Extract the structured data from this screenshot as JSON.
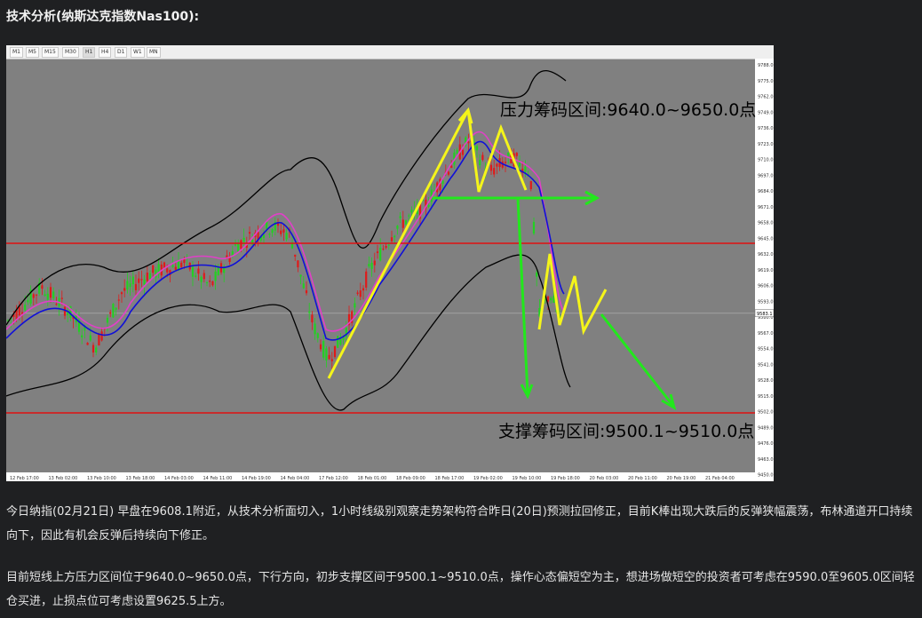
{
  "article": {
    "heading": "技术分析(纳斯达克指数Nas100):",
    "paragraph_1": "今日纳指(02月21日) 早盘在9608.1附近，从技术分析面切入，1小时线级别观察走势架构符合昨日(20日)预测拉回修正，目前K棒出现大跌后的反弹狭幅震荡，布林通道开口持续向下，因此有机会反弹后持续向下修正。",
    "paragraph_2": "目前短线上方压力区间位于9640.0~9650.0点，下行方向，初步支撑区间于9500.1~9510.0点，操作心态偏短空为主，想进场做短空的投资者可考虑在9590.0至9605.0区间轻仓买进，止损点位可考虑设置9625.5上方。"
  },
  "chart": {
    "timeframes": [
      "M1",
      "M5",
      "M15",
      "M30",
      "H1",
      "H4",
      "D1",
      "W1",
      "MN"
    ],
    "active_timeframe": "H1",
    "resistance_label": "压力筹码区间:9640.0~9650.0点",
    "support_label": "支撑筹码区间:9500.1~9510.0点",
    "price_axis_labels": [
      "9788.0",
      "9775.0",
      "9762.0",
      "9749.0",
      "9736.0",
      "9723.0",
      "9710.0",
      "9697.0",
      "9684.0",
      "9671.0",
      "9658.0",
      "9645.0",
      "9632.0",
      "9619.0",
      "9606.0",
      "9593.0",
      "9580.0",
      "9567.0",
      "9554.0",
      "9541.0",
      "9528.0",
      "9515.0",
      "9502.0",
      "9489.0",
      "9476.0",
      "9463.0",
      "9450.0"
    ],
    "current_price_tag": "9583.1",
    "time_axis_labels": [
      "12 Feb 17:00",
      "13 Feb 02:00",
      "13 Feb 10:00",
      "13 Feb 18:00",
      "14 Feb 03:00",
      "14 Feb 11:00",
      "14 Feb 19:00",
      "14 Feb 04:00",
      "17 Feb 12:00",
      "18 Feb 01:00",
      "18 Feb 09:00",
      "18 Feb 17:00",
      "19 Feb 02:00",
      "19 Feb 10:00",
      "19 Feb 18:00",
      "20 Feb 03:00",
      "20 Feb 11:00",
      "20 Feb 19:00",
      "21 Feb 04:00"
    ],
    "colors": {
      "background": "#808080",
      "bull_candle": "#22d022",
      "bear_candle": "#e01a1a",
      "bollinger": "#000000",
      "moving_average": "#1010d8",
      "signal_line": "#e040c8",
      "horizontal_level": "#e01010",
      "annotation_yellow": "#f5f51a",
      "annotation_green": "#22e81c"
    }
  }
}
